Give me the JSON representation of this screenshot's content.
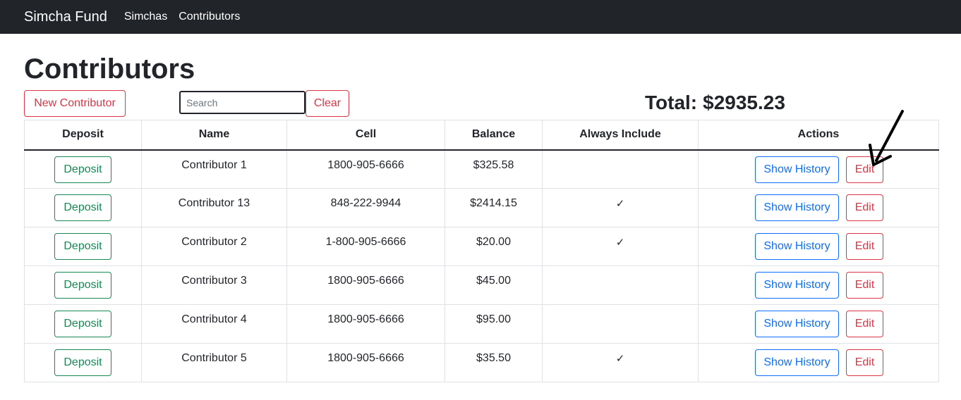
{
  "navbar": {
    "brand": "Simcha Fund",
    "links": [
      "Simchas",
      "Contributors"
    ]
  },
  "page": {
    "title": "Contributors",
    "new_button": "New Contributor",
    "search_placeholder": "Search",
    "clear_button": "Clear",
    "total_label": "Total:",
    "total_value": "$2935.23"
  },
  "table": {
    "headers": [
      "Deposit",
      "Name",
      "Cell",
      "Balance",
      "Always Include",
      "Actions"
    ],
    "deposit_label": "Deposit",
    "history_label": "Show History",
    "edit_label": "Edit",
    "check_glyph": "✓",
    "rows": [
      {
        "name": "Contributor 1",
        "cell": "1800-905-6666",
        "balance": "$325.58",
        "always_include": false
      },
      {
        "name": "Contributor 13",
        "cell": "848-222-9944",
        "balance": "$2414.15",
        "always_include": true
      },
      {
        "name": "Contributor 2",
        "cell": "1-800-905-6666",
        "balance": "$20.00",
        "always_include": true
      },
      {
        "name": "Contributor 3",
        "cell": "1800-905-6666",
        "balance": "$45.00",
        "always_include": false
      },
      {
        "name": "Contributor 4",
        "cell": "1800-905-6666",
        "balance": "$95.00",
        "always_include": false
      },
      {
        "name": "Contributor 5",
        "cell": "1800-905-6666",
        "balance": "$35.50",
        "always_include": true
      }
    ]
  },
  "annotation": {
    "icon": "arrow-pointer-icon"
  },
  "colors": {
    "navbar_bg": "#212529",
    "danger": "#dc3545",
    "success": "#198754",
    "primary": "#0d6efd"
  }
}
